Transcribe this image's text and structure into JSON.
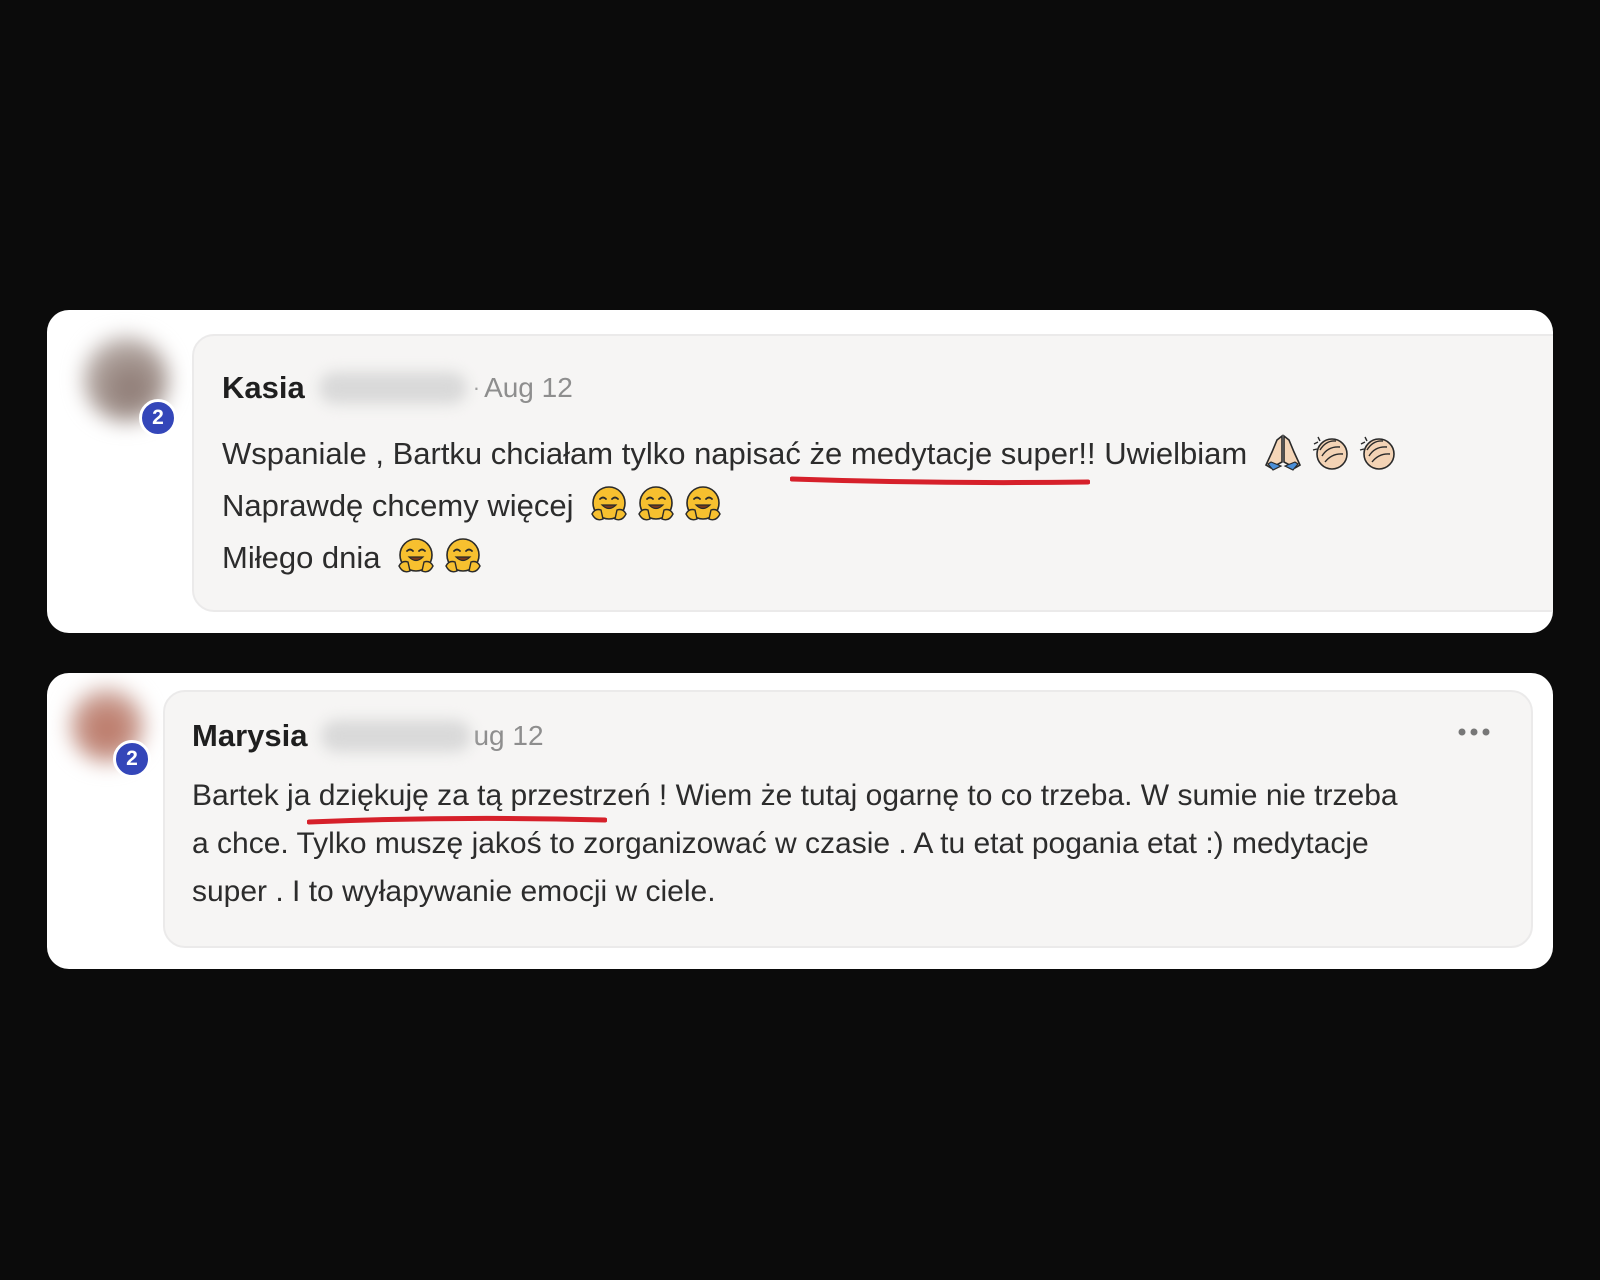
{
  "comments": [
    {
      "author": "Kasia",
      "separator": "·",
      "date": "Aug 12",
      "level": "2",
      "lines": {
        "l1_before": "Wspaniale , Bartku chciałam tylko napisać ",
        "l1_highlight": "że medytacje super!!",
        "l1_after": " Uwielbiam",
        "l1_emojis": [
          "folded-hands-icon",
          "clapping-hands-icon",
          "clapping-hands-icon"
        ],
        "l2_text": "Naprawdę chcemy więcej",
        "l2_emojis": [
          "hugging-face-icon",
          "hugging-face-icon",
          "hugging-face-icon"
        ],
        "l3_text": "Miłego dnia",
        "l3_emojis": [
          "hugging-face-icon",
          "hugging-face-icon"
        ]
      }
    },
    {
      "author": "Marysia",
      "date": "ug 12",
      "level": "2",
      "lines": {
        "l1_before": "Bartek ja ",
        "l1_highlight": "dziękuję za tą przestrzeń",
        "l1_after": " ! Wiem że tutaj ogarnę to co trzeba. W sumie nie trzeba",
        "l2_text": "a chce. Tylko muszę jakoś to zorganizować w czasie . A tu etat pogania etat :) medytacje",
        "l3_text": "super . I to wyłapywanie emocji w ciele."
      },
      "more_icon": "more-horizontal-icon"
    }
  ],
  "colors": {
    "background": "#0b0b0b",
    "card": "#ffffff",
    "bubble": "#f6f5f4",
    "badge": "#3446b9",
    "underline": "#d6202a",
    "date": "#8e8e8e"
  }
}
